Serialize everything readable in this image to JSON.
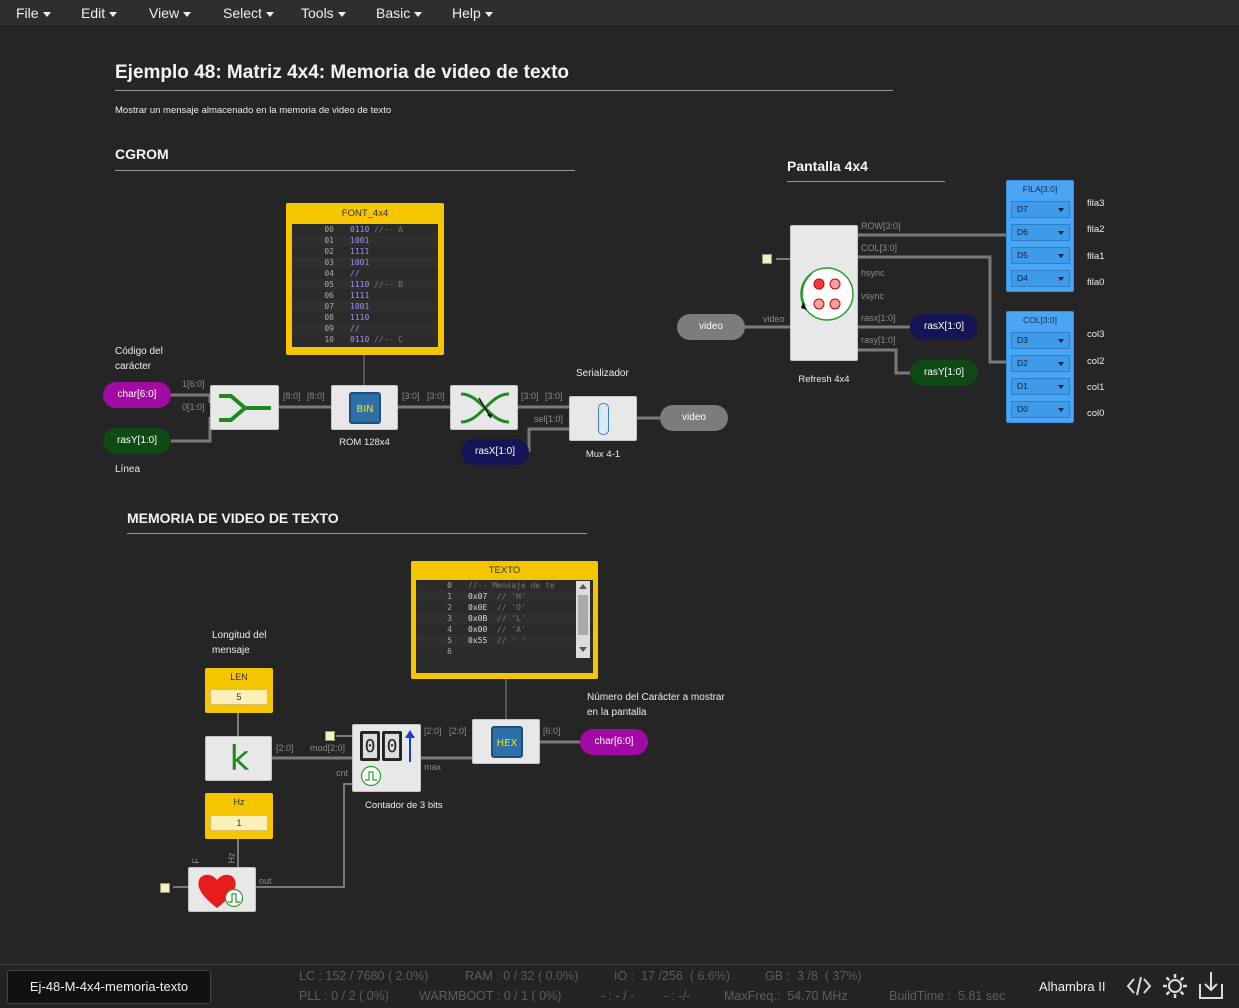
{
  "menu": [
    {
      "label": "File"
    },
    {
      "label": "Edit"
    },
    {
      "label": "View"
    },
    {
      "label": "Select"
    },
    {
      "label": "Tools"
    },
    {
      "label": "Basic"
    },
    {
      "label": "Help"
    }
  ],
  "header": {
    "title": "Ejemplo 48: Matriz 4x4: Memoria de video de texto",
    "subtitle": "Mostrar un mensaje almacenado en la memoria de video de texto"
  },
  "sections": {
    "cgrom": "CGROM",
    "pantalla": "Pantalla 4x4",
    "memoria": "MEMORIA DE VIDEO DE TEXTO"
  },
  "notes": {
    "codigo_l1": "Código del",
    "codigo_l2": "carácter",
    "linea": "Línea",
    "serializador": "Serializador",
    "longitud_l1": "Longitud del",
    "longitud_l2": "mensaje",
    "numero_l1": "Número del Carácter a mostrar",
    "numero_l2": "en la pantalla"
  },
  "font_rom": {
    "title": "FONT_4x4",
    "rows": [
      {
        "ln": "00",
        "val": "0110",
        "cmt": " //-- A"
      },
      {
        "ln": "01",
        "val": "1001",
        "cmt": ""
      },
      {
        "ln": "02",
        "val": "1111",
        "cmt": ""
      },
      {
        "ln": "03",
        "val": "1001",
        "cmt": ""
      },
      {
        "ln": "04",
        "val": "//",
        "cmt": ""
      },
      {
        "ln": "05",
        "val": "1110",
        "cmt": " //-- B"
      },
      {
        "ln": "06",
        "val": "1111",
        "cmt": ""
      },
      {
        "ln": "07",
        "val": "1001",
        "cmt": ""
      },
      {
        "ln": "08",
        "val": "1110",
        "cmt": ""
      },
      {
        "ln": "09",
        "val": "//",
        "cmt": ""
      },
      {
        "ln": "10",
        "val": "0110",
        "cmt": " //-- C"
      }
    ]
  },
  "texto_rom": {
    "title": "TEXTO",
    "rows": [
      {
        "ln": "0",
        "val": "",
        "cmt": "//-- Mensaje de te"
      },
      {
        "ln": "1",
        "val": "0x07",
        "cmt": "  // 'H'"
      },
      {
        "ln": "2",
        "val": "0x0E",
        "cmt": "  // 'O'"
      },
      {
        "ln": "3",
        "val": "0x0B",
        "cmt": "  // 'L'"
      },
      {
        "ln": "4",
        "val": "0x00",
        "cmt": "  // 'A'"
      },
      {
        "ln": "5",
        "val": "0x55",
        "cmt": "  // ' '"
      },
      {
        "ln": "6",
        "val": "",
        "cmt": ""
      }
    ]
  },
  "ports": {
    "char_in": "char[6:0]",
    "rasY_in": "rasY[1:0]",
    "rasX_in": "rasX[1:0]",
    "video_out": "video",
    "video_in": "video",
    "rasX_out": "rasX[1:0]",
    "rasY_out": "rasY[1:0]",
    "char_out": "char[6:0]"
  },
  "wire_labels": {
    "w1_6_0": "1[6:0]",
    "w0_1_0": "0[1:0]",
    "w8_0_a": "[8:0]",
    "w8_0_b": "[8:0]",
    "w3_0_a": "[3:0]",
    "w3_0_b": "[3:0]",
    "w3_0_c": "[3:0]",
    "w3_0_d": "[3:0]",
    "sel": "sel[1:0]",
    "row": "ROW[3:0]",
    "col": "COL[3:0]",
    "hsync": "hsync",
    "vsync": "vsync",
    "rasx": "rasx[1:0]",
    "rasy": "rasy[1:0]",
    "video": "video",
    "w2_0_a": "[2:0]",
    "mod": "mod[2:0]",
    "cnt": "cnt",
    "max": "max",
    "w2_0_b": "[2:0]",
    "w2_0_c": "[2:0]",
    "w6_0": "[6:0]",
    "out": "out",
    "f": "F",
    "hz": "Hz"
  },
  "blocks": {
    "rom_label": "ROM 128x4",
    "rom_badge": "BIN",
    "mux_label": "Mux 4-1",
    "refresh_label": "Refresh 4x4",
    "counter_label": "Contador de 3 bits",
    "hex_badge": "HEX",
    "k_glyph": "k",
    "counter_digits": [
      "0",
      "0"
    ]
  },
  "consts": {
    "len_title": "LEN",
    "len_value": "5",
    "hz_title": "Hz",
    "hz_value": "1"
  },
  "fila": {
    "title": "FILA[3:0]",
    "pins": [
      "D7",
      "D6",
      "D5",
      "D4"
    ],
    "names": [
      "fila3",
      "fila2",
      "fila1",
      "fila0"
    ]
  },
  "col": {
    "title": "COL[3:0]",
    "pins": [
      "D3",
      "D2",
      "D1",
      "D0"
    ],
    "names": [
      "col3",
      "col2",
      "col1",
      "col0"
    ]
  },
  "status": {
    "file": "Ej-48-M-4x4-memoria-texto",
    "lc": "LC : 152 / 7680 ( 2.0%)",
    "ram": "RAM : 0 / 32 ( 0.0%)",
    "io": "IO :  17 /256  ( 6.6%)",
    "gb": "GB :  3 /8  ( 37%)",
    "pll": "PLL : 0 / 2 ( 0%)",
    "warmboot": "WARMBOOT : 0 / 1 ( 0%)",
    "dash1": "- : - / -",
    "dash2": "- : -/-",
    "maxfreq": "MaxFreq.:  54.70 MHz",
    "buildtime": "BuildTime :  5.81 sec",
    "board": "Alhambra II"
  }
}
